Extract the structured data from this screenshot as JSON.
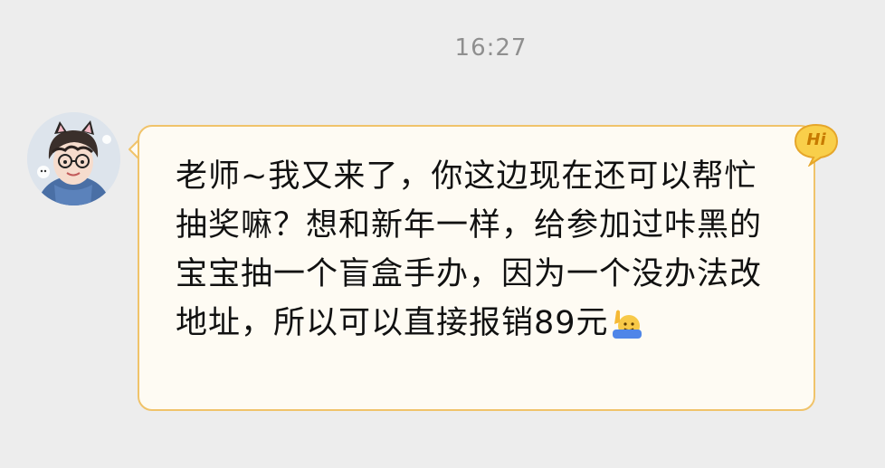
{
  "timestamp": "16:27",
  "message": {
    "text": "老师~我又来了，你这边现在还可以帮忙抽奖嘛？想和新年一样，给参加过咔黑的宝宝抽一个盲盒手办，因为一个没办法改地址，所以可以直接报销89元",
    "emoji": "raising-hand-emoji",
    "badge": "Hi"
  },
  "colors": {
    "background": "#ededed",
    "bubble_fill": "#fefbf3",
    "bubble_border": "#f0c36a",
    "timestamp_text": "#8f8f8f",
    "badge_fill": "#f7c63c"
  }
}
